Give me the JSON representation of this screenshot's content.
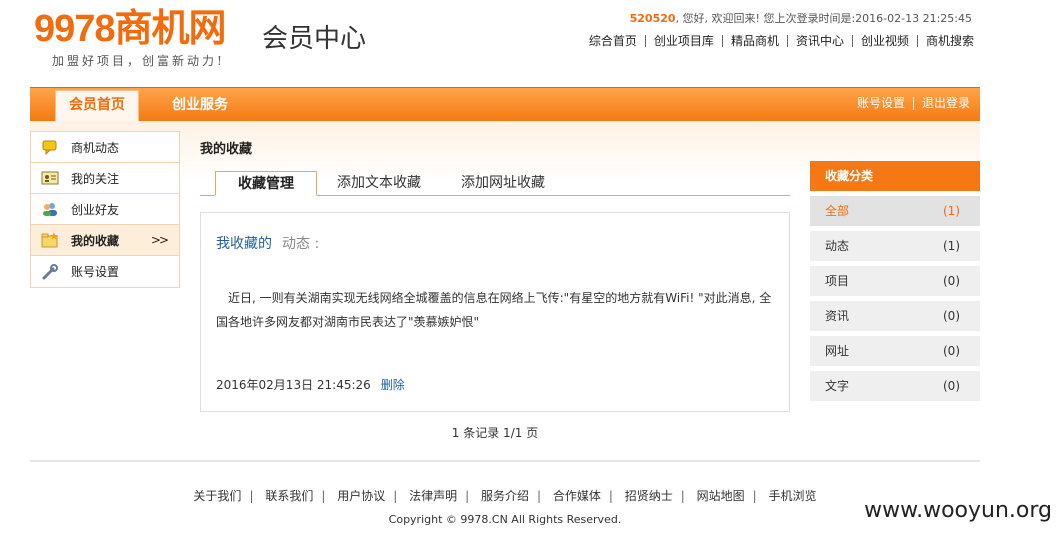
{
  "header": {
    "logo_text": "9978商机网",
    "logo_slogan": "加盟好项目，创富新动力!",
    "member_center": "会员中心",
    "welcome_user": "520520",
    "welcome_text": ", 您好, 欢迎回来!  您上次登录时间是:2016-02-13 21:25:45",
    "top_nav": [
      "综合首页",
      "创业项目库",
      "精品商机",
      "资讯中心",
      "创业视频",
      "商机搜索"
    ]
  },
  "orange_bar": {
    "tab_home": "会员首页",
    "tab_biz": "创业服务",
    "right_links": [
      "账号设置",
      "退出登录"
    ]
  },
  "left_menu": {
    "items": [
      {
        "label": "商机动态",
        "icon": "chat-bubble-icon"
      },
      {
        "label": "我的关注",
        "icon": "id-card-icon"
      },
      {
        "label": "创业好友",
        "icon": "users-icon"
      },
      {
        "label": "我的收藏",
        "icon": "folder-star-icon",
        "arrow": ">>"
      },
      {
        "label": "账号设置",
        "icon": "wrench-icon"
      }
    ]
  },
  "main": {
    "title": "我的收藏",
    "tabs": [
      "收藏管理",
      "添加文本收藏",
      "添加网址收藏"
    ],
    "fav": {
      "head_mine": "我收藏的",
      "head_kind": "动态 :",
      "text": "近日, 一则有关湖南实现无线网络全城覆盖的信息在网络上飞传:\"有星空的地方就有WiFi! \"对此消息, 全国各地许多网友都对湖南市民表达了\"羡慕嫉妒恨\"",
      "date": "2016年02月13日 21:45:26",
      "delete": "删除"
    },
    "pager": "1 条记录 1/1 页"
  },
  "categories": {
    "title": "收藏分类",
    "items": [
      {
        "label": "全部",
        "count": "(1)"
      },
      {
        "label": "动态",
        "count": "(1)"
      },
      {
        "label": "项目",
        "count": "(0)"
      },
      {
        "label": "资讯",
        "count": "(0)"
      },
      {
        "label": "网址",
        "count": "(0)"
      },
      {
        "label": "文字",
        "count": "(0)"
      }
    ]
  },
  "footer": {
    "links": [
      "关于我们",
      "联系我们",
      "用户协议",
      "法律声明",
      "服务介绍",
      "合作媒体",
      "招贤纳士",
      "网站地图",
      "手机浏览"
    ],
    "copyright": "Copyright © 9978.CN All Rights Reserved."
  },
  "watermark": "www.wooyun.org",
  "colors": {
    "accent_orange": "#f26c0d",
    "link_blue": "#1f5f9f"
  }
}
